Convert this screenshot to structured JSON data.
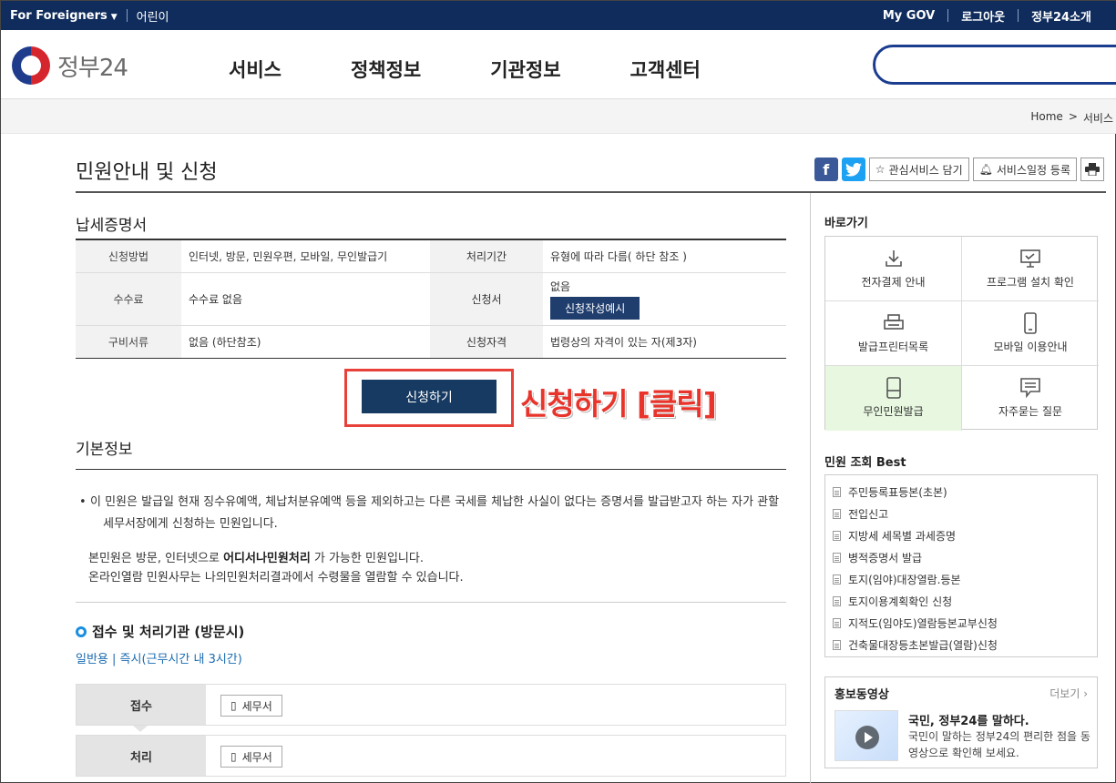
{
  "topbar": {
    "foreigners": "For Foreigners",
    "kids": "어린이",
    "my_gov": "My GOV",
    "logout": "로그아웃",
    "about": "정부24소개"
  },
  "header": {
    "logo_text": "정부24",
    "nav": [
      "서비스",
      "정책정보",
      "기관정보",
      "고객센터"
    ]
  },
  "breadcrumb": {
    "home": "Home",
    "sep": ">",
    "current": "서비스"
  },
  "page": {
    "title": "민원안내 및 신청",
    "tools": {
      "interest": "관심서비스 담기",
      "schedule": "서비스일정 등록"
    }
  },
  "service": {
    "name": "납세증명서",
    "table": {
      "method_label": "신청방법",
      "method_value": "인터넷, 방문, 민원우편, 모바일, 무인발급기",
      "period_label": "처리기간",
      "period_value": "유형에 따라 다름( 하단 참조 )",
      "fee_label": "수수료",
      "fee_value": "수수료 없음",
      "form_label": "신청서",
      "form_value": "없음",
      "form_button": "신청작성예시",
      "docs_label": "구비서류",
      "docs_value": "없음 (하단참조)",
      "qual_label": "신청자격",
      "qual_value": "법령상의 자격이 있는 자(제3자)"
    },
    "apply_button": "신청하기",
    "annotation": "신청하기 [클릭]"
  },
  "basic": {
    "title": "기본정보",
    "desc_line1": "이 민원은 발급일 현재 징수유예액, 체납처분유예액 등을 제외하고는 다른 국세를 체납한 사실이 없다는 증명서를 발급받고자 하는 자가 관할",
    "desc_line2": "세무서장에게 신청하는 민원입니다.",
    "note_pre": "본민원은 방문, 인터넷으로 ",
    "note_bold": "어디서나민원처리",
    "note_post": " 가 가능한 민원입니다.",
    "note_line2": "온라인열람 민원사무는 나의민원처리결과에서 수령물을 열람할 수 있습니다."
  },
  "process": {
    "title": "접수 및 처리기관 (방문시)",
    "subtitle": "일반용 | 즉시(근무시간 내 3시간)",
    "receive_label": "접수",
    "receive_office": "세무서",
    "handle_label": "처리",
    "handle_office": "세무서"
  },
  "sidebar": {
    "shortcut_title": "바로가기",
    "shortcuts": [
      {
        "label": "전자결제 안내",
        "icon": "download-icon"
      },
      {
        "label": "프로그램 설치 확인",
        "icon": "monitor-icon"
      },
      {
        "label": "발급프린터목록",
        "icon": "printer-icon"
      },
      {
        "label": "모바일 이용안내",
        "icon": "mobile-icon"
      },
      {
        "label": "무인민원발급",
        "icon": "kiosk-icon"
      },
      {
        "label": "자주묻는 질문",
        "icon": "chat-icon"
      }
    ],
    "best_title": "민원 조회 Best",
    "best": [
      "주민등록표등본(초본)",
      "전입신고",
      "지방세 세목별 과세증명",
      "병적증명서 발급",
      "토지(임야)대장열람.등본",
      "토지이용계획확인 신청",
      "지적도(임야도)열람등본교부신청",
      "건축물대장등초본발급(열람)신청"
    ],
    "promo": {
      "title": "홍보동영상",
      "more": "더보기 ›",
      "video_title": "국민, 정부24를 말하다.",
      "video_desc": "국민이 말하는 정부24의 편리한 점을 동영상으로 확인해 보세요."
    }
  }
}
